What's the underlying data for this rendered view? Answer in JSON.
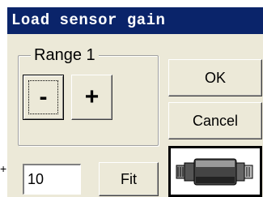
{
  "window": {
    "title": "Load sensor gain"
  },
  "group": {
    "label": "Range 1"
  },
  "buttons": {
    "minus": "-",
    "plus": "+",
    "ok": "OK",
    "cancel": "Cancel",
    "fit": "Fit"
  },
  "gain_input": {
    "value": "10"
  },
  "sensor_image": {
    "icon": "load-sensor-icon"
  },
  "colors": {
    "titlebar": "#0a246a",
    "dialog_bg": "#ece9d8"
  }
}
